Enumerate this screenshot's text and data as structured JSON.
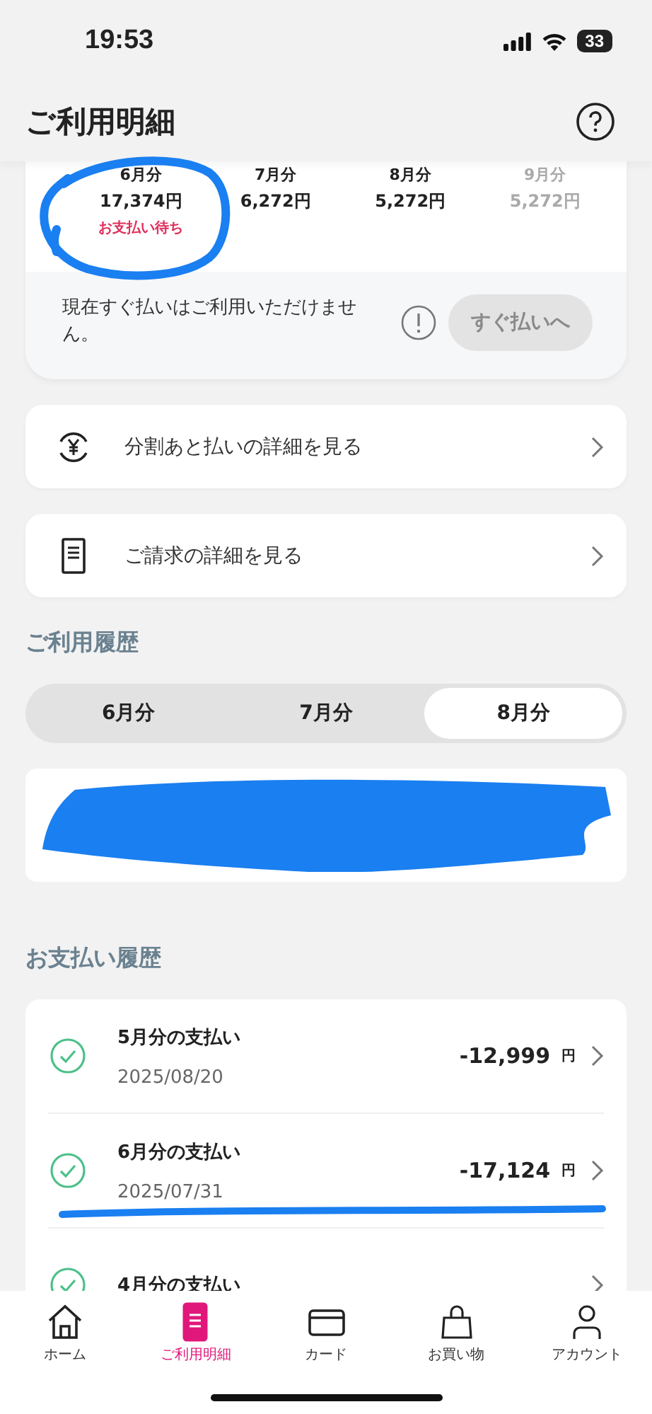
{
  "status_bar": {
    "time": "19:53",
    "battery": "33"
  },
  "header": {
    "title": "ご利用明細"
  },
  "months": [
    {
      "label": "6月分",
      "amount": "17,374円",
      "status": "お支払い待ち",
      "disabled": false
    },
    {
      "label": "7月分",
      "amount": "6,272円",
      "disabled": false
    },
    {
      "label": "8月分",
      "amount": "5,272円",
      "disabled": false
    },
    {
      "label": "9月分",
      "amount": "5,272円",
      "disabled": true
    }
  ],
  "notice": {
    "text": "現在すぐ払いはご利用いただけません。",
    "button": "すぐ払いへ",
    "button_disabled": true
  },
  "links": [
    {
      "kind": "installment",
      "label": "分割あと払いの詳細を見る"
    },
    {
      "kind": "bill",
      "label": "ご請求の詳細を見る"
    }
  ],
  "usage": {
    "heading": "ご利用履歴",
    "tabs": [
      {
        "label": "6月分",
        "selected": false
      },
      {
        "label": "7月分",
        "selected": false
      },
      {
        "label": "8月分",
        "selected": true
      }
    ]
  },
  "payments": {
    "heading": "お支払い履歴",
    "rows": [
      {
        "title": "5月分の支払い",
        "date": "2025/08/20",
        "amount": "-12,999",
        "unit": "円"
      },
      {
        "title": "6月分の支払い",
        "date": "2025/07/31",
        "amount": "-17,124",
        "unit": "円"
      },
      {
        "title": "4月分の支払い"
      }
    ]
  },
  "tab_bar": [
    {
      "kind": "home",
      "label": "ホーム",
      "selected": false
    },
    {
      "kind": "statement",
      "label": "ご利用明細",
      "selected": true
    },
    {
      "kind": "card",
      "label": "カード",
      "selected": false
    },
    {
      "kind": "shopping",
      "label": "お買い物",
      "selected": false
    },
    {
      "kind": "account",
      "label": "アカウント",
      "selected": false
    }
  ]
}
